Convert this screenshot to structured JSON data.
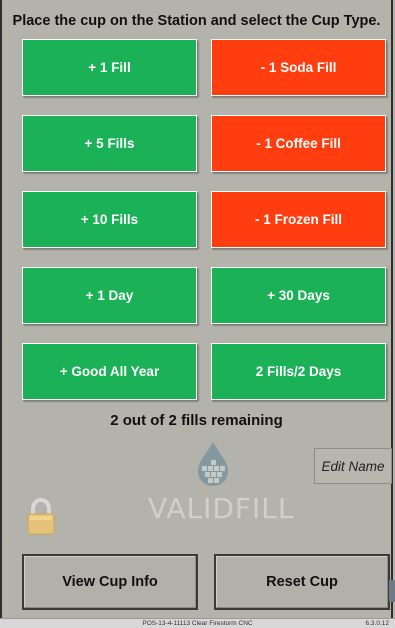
{
  "header": {
    "instruction": "Place the cup on the Station and select the Cup Type."
  },
  "buttons": {
    "plus_1_fill": "+ 1 Fill",
    "minus_1_soda_fill": "- 1 Soda Fill",
    "plus_5_fills": "+ 5 Fills",
    "minus_1_coffee_fill": "- 1 Coffee Fill",
    "plus_10_fills": "+ 10 Fills",
    "minus_1_frozen_fill": "- 1 Frozen Fill",
    "plus_1_day": "+ 1 Day",
    "plus_30_days": "+ 30 Days",
    "plus_good_all_year": "+ Good All Year",
    "two_fills_two_days": "2 Fills/2 Days"
  },
  "status": {
    "remaining": "2 out of 2 fills remaining"
  },
  "edit_name_label": "Edit Name",
  "logo": {
    "text": "VALIDFILL"
  },
  "bottom": {
    "view_cup_info": "View Cup Info",
    "reset_cup": "Reset Cup"
  },
  "statusbar": {
    "station": "POS-13-4-11113 Clear Firestorm CNC",
    "version": "6.3.0.12"
  },
  "colors": {
    "green": "#1bb156",
    "red": "#ff3d0e",
    "background": "#b3b3ab"
  },
  "icons": [
    "validfill-logo-icon",
    "lock-icon"
  ]
}
